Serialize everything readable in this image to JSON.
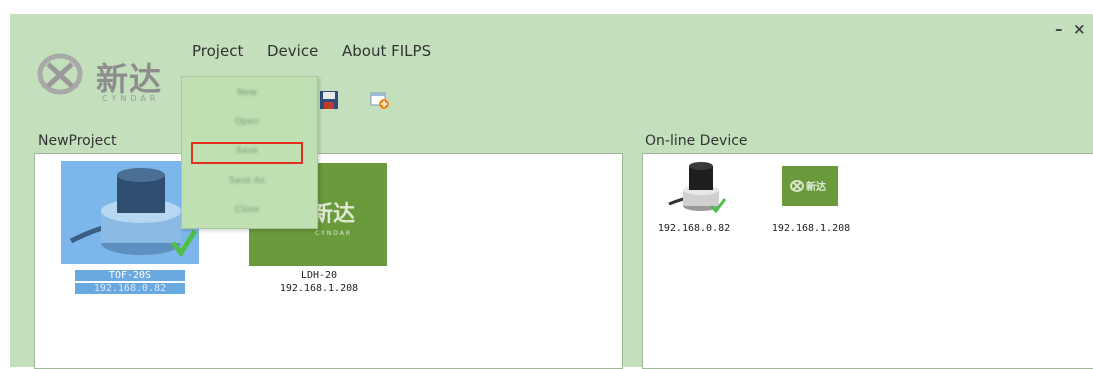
{
  "logo": {
    "text": "新达",
    "sub": "CYNDAR"
  },
  "menu": {
    "project": "Project",
    "device": "Device",
    "about": "About FILPS"
  },
  "window": {
    "minimize": "–",
    "close": "×"
  },
  "project_dropdown": {
    "items": [
      "New",
      "Open",
      "Save",
      "Save As",
      "Close"
    ],
    "selected_index": 2
  },
  "panels": {
    "project": {
      "title": "NewProject",
      "devices": [
        {
          "name": "TOF-20S",
          "ip": "192.168.0.82",
          "selected": true,
          "type": "sensor"
        },
        {
          "name": "LDH-20",
          "ip": "192.168.1.208",
          "selected": false,
          "type": "cyndar-logo"
        }
      ]
    },
    "online": {
      "title": "On-line Device",
      "devices": [
        {
          "ip": "192.168.0.82",
          "type": "sensor"
        },
        {
          "ip": "192.168.1.208",
          "type": "cyndar-logo"
        }
      ]
    }
  },
  "colors": {
    "app_background": "#c4dfbc",
    "selection_blue": "#6aa9e0",
    "cyndar_green": "#6a9a3c",
    "highlight_red": "#e0301e"
  }
}
